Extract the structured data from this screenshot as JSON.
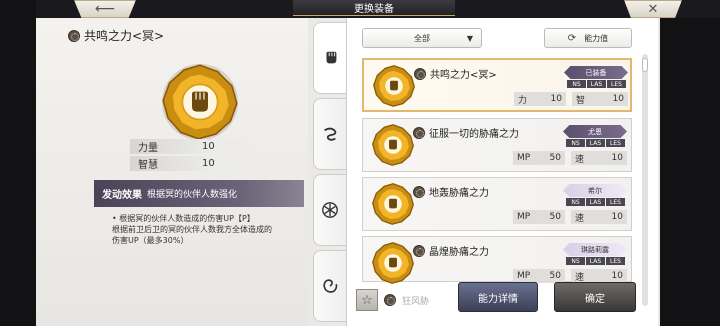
{
  "header": {
    "title": "更换装备",
    "back_icon": "arrow-left-icon",
    "close_icon": "close-x-icon"
  },
  "detail": {
    "name": "共鸣之力<冥>",
    "gem_icon": "fist-gem-icon",
    "stats": [
      {
        "label": "力量",
        "value": "10"
      },
      {
        "label": "智慧",
        "value": "10"
      }
    ],
    "effect_label": "发动效果",
    "effect_summary": "根据冥的伙伴人数强化",
    "effect_lines": [
      "• 根据冥的伙伴人数造成的伤害UP【P】",
      "根据前卫后卫的冥的伙伴人数我方全体造成的",
      "伤害UP（最多30%）"
    ]
  },
  "tabs": [
    {
      "icon": "fist-icon"
    },
    {
      "icon": "swirl-icon"
    },
    {
      "icon": "snowflake-icon"
    },
    {
      "icon": "spiral-icon"
    }
  ],
  "filter": {
    "selected": "全部",
    "sort_label": "能力值",
    "sort_icon": "refresh-icon"
  },
  "list": [
    {
      "name": "共鸣之力<冥>",
      "badge": "已装备",
      "badge_style": "dark",
      "attrs": [
        "NS",
        "LAS",
        "LES"
      ],
      "stat1_label": "力",
      "stat1_value": "10",
      "stat2_label": "智",
      "stat2_value": "10",
      "selected": true
    },
    {
      "name": "征服一切的胁痛之力",
      "badge": "尤恩",
      "badge_style": "dark",
      "attrs": [
        "NS",
        "LAS",
        "LES"
      ],
      "stat1_label": "MP",
      "stat1_value": "50",
      "stat2_label": "速",
      "stat2_value": "10",
      "selected": false
    },
    {
      "name": "地轰胁痛之力",
      "badge": "希尔",
      "badge_style": "light",
      "attrs": [
        "NS",
        "LAS",
        "LES"
      ],
      "stat1_label": "MP",
      "stat1_value": "50",
      "stat2_label": "速",
      "stat2_value": "10",
      "selected": false
    },
    {
      "name": "晶煌胁痛之力",
      "badge": "琪路莉露",
      "badge_style": "light",
      "attrs": [
        "NS",
        "LAS",
        "LES"
      ],
      "stat1_label": "MP",
      "stat1_value": "50",
      "stat2_label": "速",
      "stat2_value": "10",
      "selected": false
    }
  ],
  "bottom": {
    "peek_name": "狂风胁",
    "detail_button": "能力详情",
    "confirm_button": "确定"
  }
}
